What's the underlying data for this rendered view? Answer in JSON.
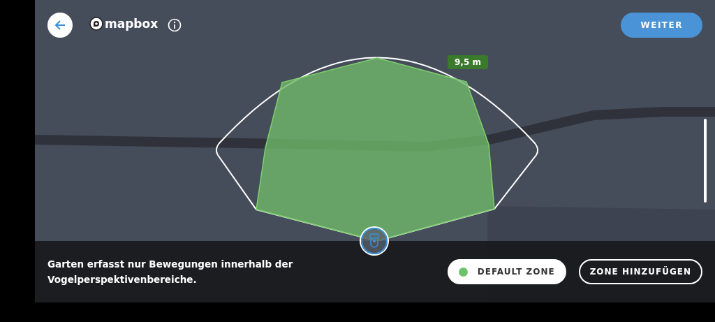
{
  "top_bar": {
    "map_attribution": "mapbox",
    "next_button": "WEITER"
  },
  "map": {
    "distance_label": "9,5 m"
  },
  "info_panel": {
    "message": "Garten erfasst nur Bewegungen innerhalb der Vogelperspektivenbereiche.",
    "zones": [
      {
        "label": "DEFAULT ZONE",
        "color": "#6cc26a",
        "selected": true
      }
    ],
    "add_zone_button": "ZONE HINZUFÜGEN"
  }
}
